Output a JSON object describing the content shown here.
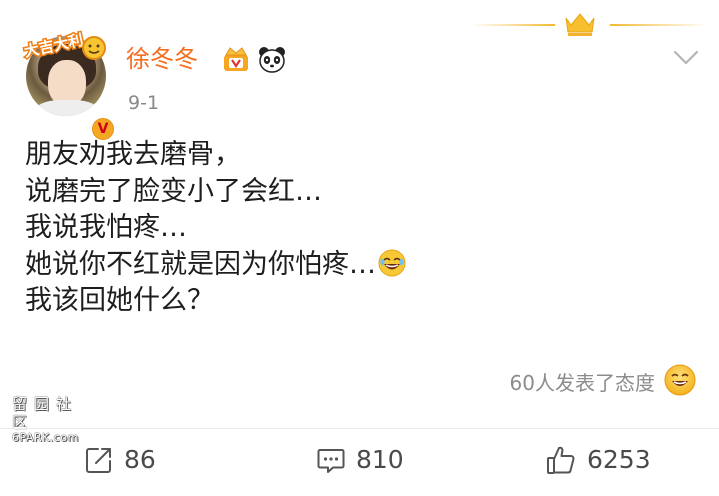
{
  "post": {
    "username": "徐冬冬",
    "date": "9-1",
    "verified_mark": "V",
    "avatar_sticker_text": "大吉大利",
    "content_lines": [
      "朋友劝我去磨骨，",
      "说磨完了脸变小了会红…",
      "我说我怕疼…",
      "她说你不红就是因为你怕疼…",
      "我该回她什么？"
    ],
    "reactions_text": "60人发表了态度",
    "icons": {
      "vip": "vip-crown-icon",
      "panda": "panda-icon",
      "chevron": "chevron-down-icon",
      "laugh_emoji": "laugh-emoji-icon",
      "reaction": "smile-face-icon"
    }
  },
  "actions": {
    "repost_count": "86",
    "comment_count": "810",
    "like_count": "6253"
  },
  "watermark": {
    "top": "留园社区",
    "bottom": "6PARK.com"
  },
  "colors": {
    "username": "#f86c1e",
    "gold": "#f5a623",
    "text": "#1e1e1e",
    "muted": "#8c8c8c"
  }
}
